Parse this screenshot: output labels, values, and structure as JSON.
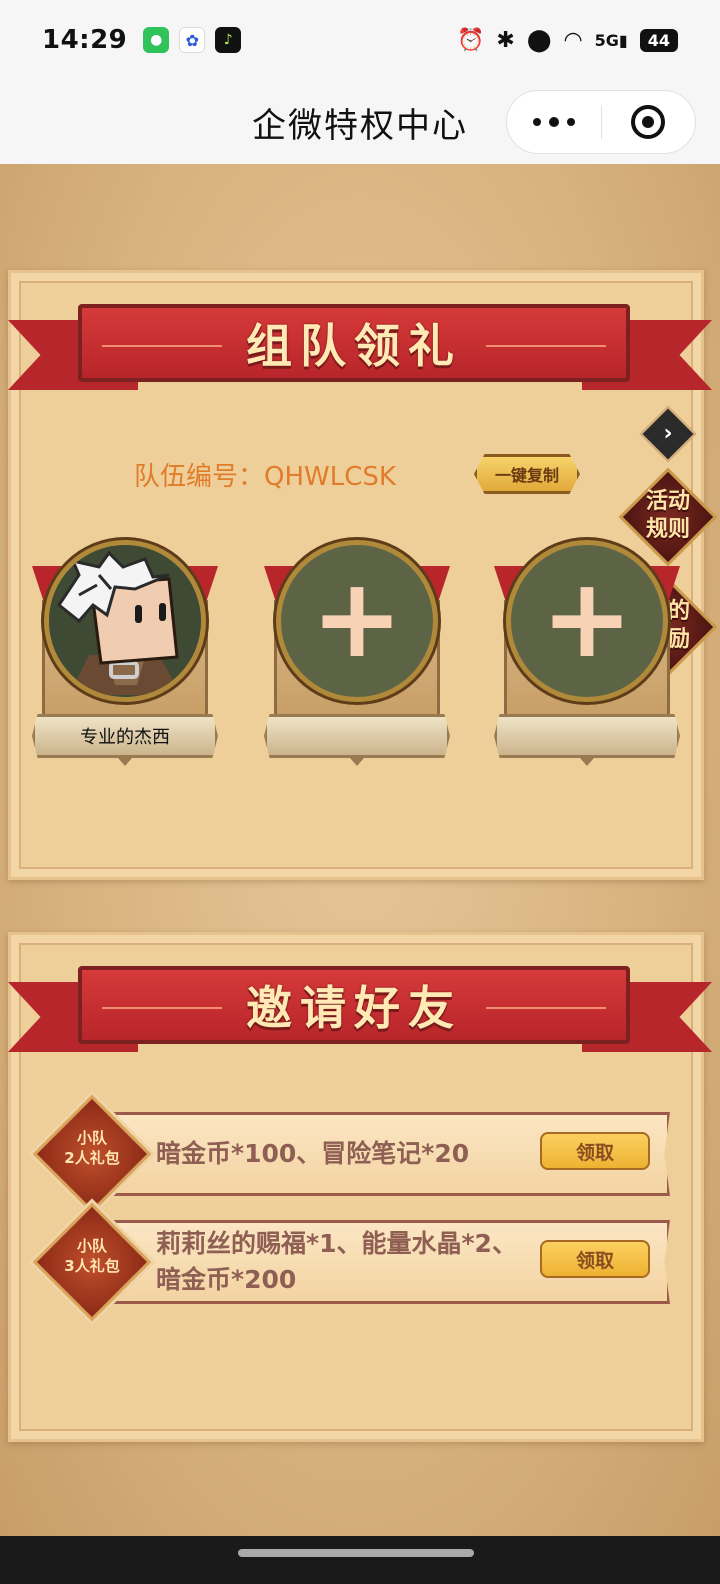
{
  "status_bar": {
    "time": "14:29",
    "battery": "44",
    "network": "5G"
  },
  "nav": {
    "title": "企微特权中心"
  },
  "team_section": {
    "title": "组队领礼",
    "team_id_label": "队伍编号：QHWLCSK",
    "copy_button": "一键复制",
    "members": [
      {
        "name": "专业的杰西"
      },
      {
        "name": ""
      },
      {
        "name": ""
      }
    ]
  },
  "side_buttons": {
    "rules": "活动\n规则",
    "rewards": "我的\n奖励"
  },
  "invite_section": {
    "title": "邀请好友",
    "rewards": [
      {
        "badge_line1": "小队",
        "badge_line2": "2人礼包",
        "desc": "暗金币*100、冒险笔记*20",
        "claim": "领取"
      },
      {
        "badge_line1": "小队",
        "badge_line2": "3人礼包",
        "desc_line1": "莉莉丝的赐福*1、能量水晶*2、",
        "desc_line2": "暗金币*200",
        "claim": "领取"
      }
    ]
  },
  "colors": {
    "ribbon_red": "#b8252a",
    "team_id_orange": "#e07c2a",
    "claim_yellow": "#f5c040"
  }
}
